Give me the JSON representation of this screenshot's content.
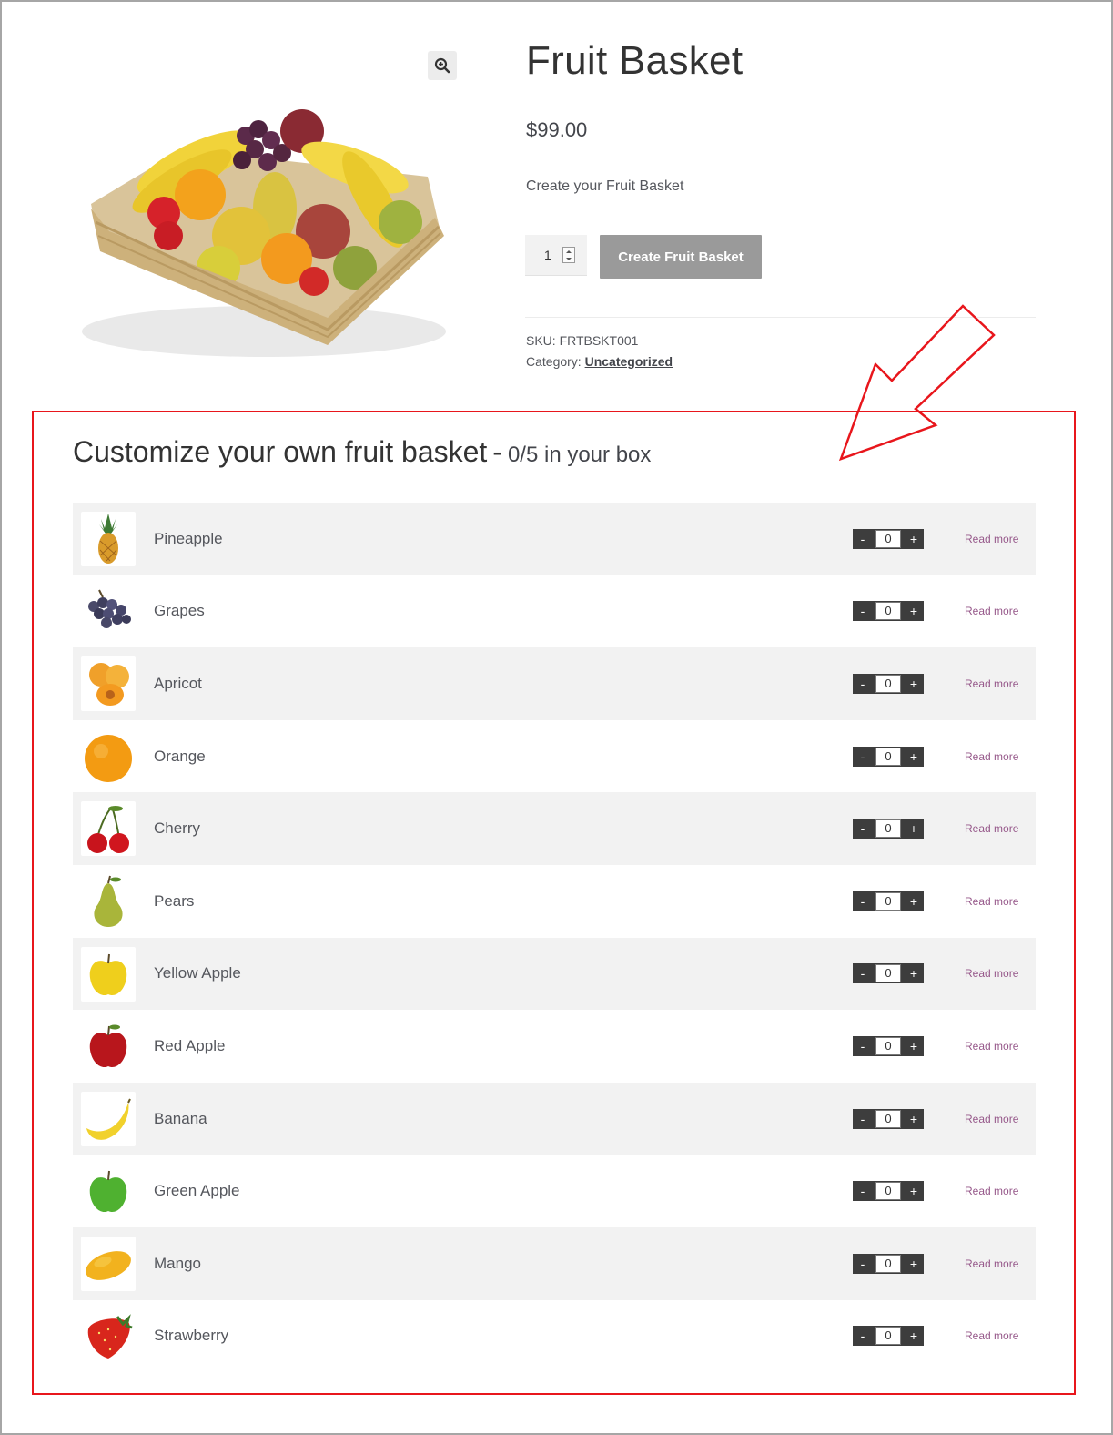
{
  "product": {
    "title": "Fruit Basket",
    "price": "$99.00",
    "description": "Create your Fruit Basket",
    "quantity": "1",
    "add_button_label": "Create Fruit Basket",
    "sku_label": "SKU:",
    "sku_value": "FRTBSKT001",
    "category_label": "Category:",
    "category_value": "Uncategorized",
    "zoom_icon": "zoom-in-icon"
  },
  "customize": {
    "heading": "Customize your own fruit basket",
    "separator": "-",
    "count_text": "0/5 in your box",
    "minus_label": "-",
    "plus_label": "+",
    "read_more_label": "Read more",
    "items": [
      {
        "name": "Pineapple",
        "qty": "0",
        "icon": "pineapple-icon"
      },
      {
        "name": "Grapes",
        "qty": "0",
        "icon": "grapes-icon"
      },
      {
        "name": "Apricot",
        "qty": "0",
        "icon": "apricot-icon"
      },
      {
        "name": "Orange",
        "qty": "0",
        "icon": "orange-icon"
      },
      {
        "name": "Cherry",
        "qty": "0",
        "icon": "cherry-icon"
      },
      {
        "name": "Pears",
        "qty": "0",
        "icon": "pear-icon"
      },
      {
        "name": "Yellow Apple",
        "qty": "0",
        "icon": "yellow-apple-icon"
      },
      {
        "name": "Red Apple",
        "qty": "0",
        "icon": "red-apple-icon"
      },
      {
        "name": "Banana",
        "qty": "0",
        "icon": "banana-icon"
      },
      {
        "name": "Green Apple",
        "qty": "0",
        "icon": "green-apple-icon"
      },
      {
        "name": "Mango",
        "qty": "0",
        "icon": "mango-icon"
      },
      {
        "name": "Strawberry",
        "qty": "0",
        "icon": "strawberry-icon"
      }
    ]
  },
  "colors": {
    "highlight_red": "#e8161c",
    "button_gray": "#9a9a9a",
    "link_purple": "#96588a",
    "row_shade": "#f2f2f2"
  }
}
